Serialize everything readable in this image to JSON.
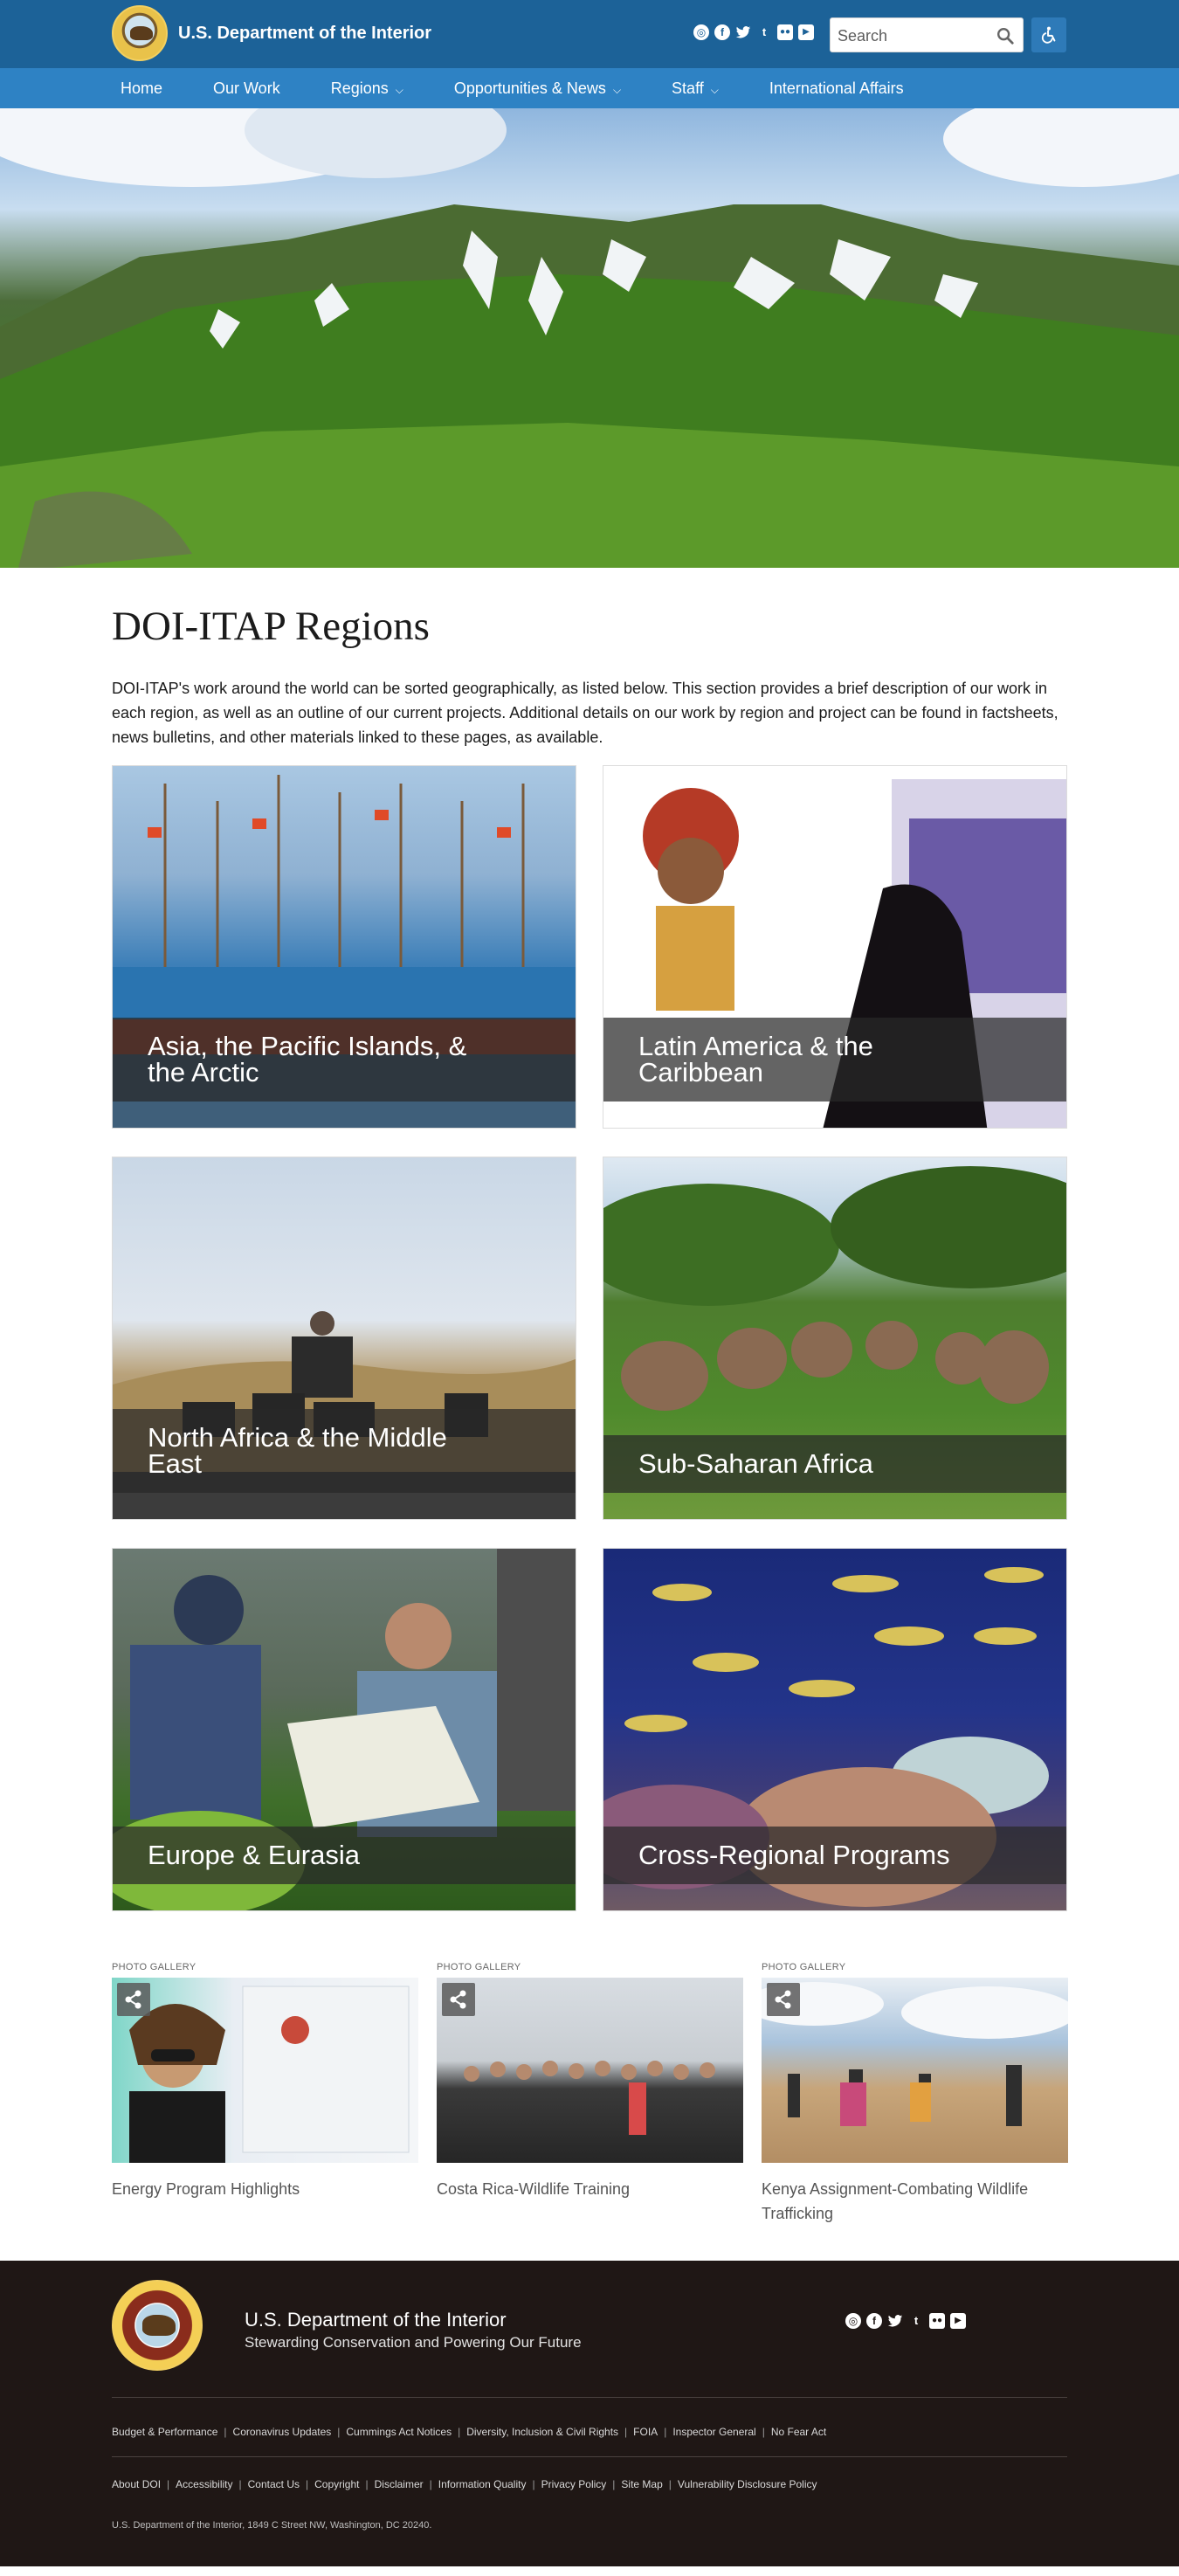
{
  "header": {
    "site_title": "U.S. Department of the Interior",
    "search_placeholder": "Search",
    "social_icons": [
      "instagram-icon",
      "facebook-icon",
      "twitter-icon",
      "tumblr-icon",
      "flickr-icon",
      "youtube-icon"
    ],
    "brand_color": "#1c6298"
  },
  "nav": {
    "items": [
      {
        "label": "Home",
        "has_dropdown": false
      },
      {
        "label": "Our Work",
        "has_dropdown": false
      },
      {
        "label": "Regions",
        "has_dropdown": true
      },
      {
        "label": "Opportunities & News",
        "has_dropdown": true
      },
      {
        "label": "Staff",
        "has_dropdown": true
      },
      {
        "label": "International Affairs",
        "has_dropdown": false
      }
    ],
    "color": "#2e82c4"
  },
  "page": {
    "title": "DOI-ITAP Regions",
    "intro": "DOI-ITAP's work around the world can be sorted geographically, as listed below. This section provides a brief description of our work in each region, as well as an outline of our current projects. Additional details on our work by region and project can be found in factsheets, news bulletins, and other materials linked to these pages, as available."
  },
  "regions": [
    {
      "line1": "Asia, the Pacific Islands, &",
      "line2": "the Arctic"
    },
    {
      "line1": "Latin America & the",
      "line2": "Caribbean"
    },
    {
      "line1": "North Africa & the Middle",
      "line2": "East"
    },
    {
      "line1": "Sub-Saharan Africa",
      "line2": ""
    },
    {
      "line1": "Europe & Eurasia",
      "line2": ""
    },
    {
      "line1": "Cross-Regional Programs",
      "line2": ""
    }
  ],
  "gallery": [
    {
      "tag": "PHOTO GALLERY",
      "title": "Energy Program Highlights"
    },
    {
      "tag": "PHOTO GALLERY",
      "title": "Costa Rica-Wildlife Training"
    },
    {
      "tag": "PHOTO GALLERY",
      "title": "Kenya Assignment-Combating Wildlife Trafficking"
    }
  ],
  "footer": {
    "name": "U.S. Department of the Interior",
    "tagline": "Stewarding Conservation and Powering Our Future",
    "links_row1": [
      "Budget & Performance",
      "Coronavirus Updates",
      "Cummings Act Notices",
      "Diversity, Inclusion & Civil Rights",
      "FOIA",
      "Inspector General",
      "No Fear Act"
    ],
    "links_row2": [
      "About DOI",
      "Accessibility",
      "Contact Us",
      "Copyright",
      "Disclaimer",
      "Information Quality",
      "Privacy Policy",
      "Site Map",
      "Vulnerability Disclosure Policy"
    ],
    "address": "U.S. Department of the Interior, 1849 C Street NW, Washington, DC 20240.",
    "background": "#1f1715"
  }
}
